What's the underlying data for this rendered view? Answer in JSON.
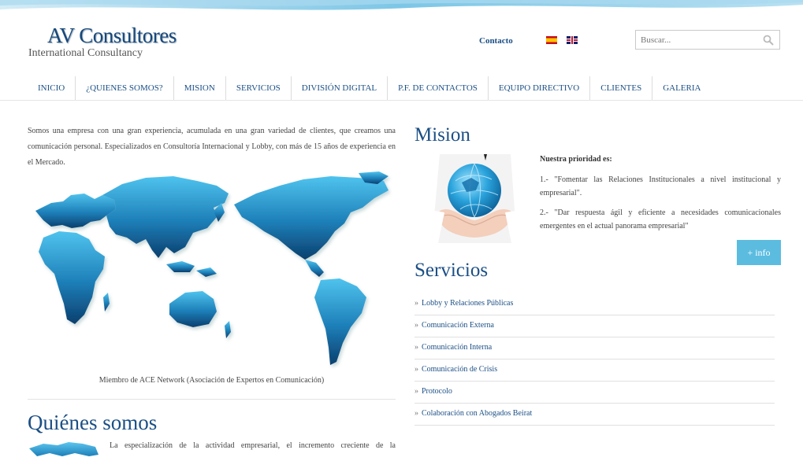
{
  "header": {
    "logo_main": "AV Consultores",
    "logo_sub": "International Consultancy",
    "contact_link": "Contacto",
    "search_placeholder": "Buscar..."
  },
  "nav": {
    "items": [
      "INICIO",
      "¿QUIENES SOMOS?",
      "MISION",
      "SERVICIOS",
      "DIVISIÓN DIGITAL",
      "P.F. DE CONTACTOS",
      "EQUIPO DIRECTIVO",
      "CLIENTES",
      "GALERIA"
    ]
  },
  "intro": {
    "text": "Somos una empresa con una gran experiencia, acumulada en una gran variedad de clientes, que creamos una comunicación personal. Especializados en Consultoría Internacional y Lobby, con más de 15 años de experiencia en el Mercado.",
    "map_caption": "Miembro de ACE Network (Asociación de Expertos en Comunicación)"
  },
  "quienes": {
    "heading": "Quiénes somos",
    "text": "La especialización de la actividad empresarial, el incremento creciente de la"
  },
  "mision": {
    "heading": "Mision",
    "priority_title": "Nuestra prioridad es:",
    "point_1": "1.- \"Fomentar las Relaciones Institucionales a nivel institucional y empresarial\".",
    "point_2": "2.- \"Dar respuesta ágil y eficiente a necesidades comunicacionales emergentes en el actual panorama empresarial\"",
    "info_button": "+ info"
  },
  "servicios": {
    "heading": "Servicios",
    "items": [
      "Lobby y Relaciones Públicas",
      "Comunicación Externa",
      "Comunicación Interna",
      "Comunicación de Crisis",
      "Protocolo",
      "Colaboración con Abogados Beirat"
    ]
  },
  "colors": {
    "brand_blue": "#1b4f85",
    "accent_cyan": "#5bbce0"
  },
  "icons": {
    "search": "search-icon",
    "flag_es": "flag-es-icon",
    "flag_en": "flag-en-icon"
  }
}
